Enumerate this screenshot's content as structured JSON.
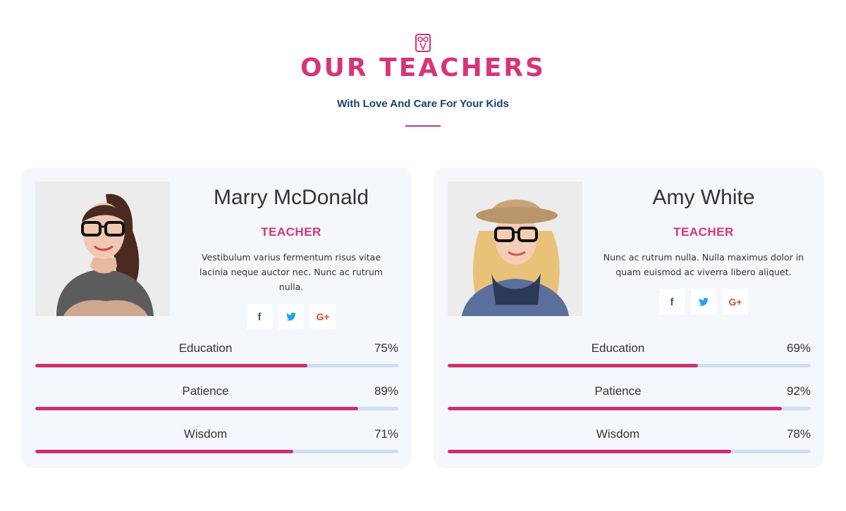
{
  "header": {
    "icon": "owl-icon",
    "title": "OUR TEACHERS",
    "subtitle": "With Love And Care For Your Kids",
    "accent_color": "#d63578",
    "subtitle_color": "#1e3e73"
  },
  "teachers": [
    {
      "name": "Marry McDonald",
      "role": "TEACHER",
      "bio": "Vestibulum varius fermentum risus vitae lacinia neque auctor nec. Nunc ac rutrum nulla.",
      "photo": "teacher-photo",
      "socials": [
        {
          "icon": "facebook-icon",
          "glyph": "f"
        },
        {
          "icon": "twitter-icon",
          "glyph": "🐦"
        },
        {
          "icon": "google-plus-icon",
          "glyph": "G+"
        }
      ],
      "skills": [
        {
          "label": "Education",
          "percent_label": "75%",
          "percent": 75
        },
        {
          "label": "Patience",
          "percent_label": "89%",
          "percent": 89
        },
        {
          "label": "Wisdom",
          "percent_label": "71%",
          "percent": 71
        }
      ]
    },
    {
      "name": "Amy White",
      "role": "TEACHER",
      "bio": "Nunc ac rutrum nulla. Nulla maximus dolor in quam euismod ac viverra libero aliquet.",
      "photo": "teacher-photo",
      "socials": [
        {
          "icon": "facebook-icon",
          "glyph": "f"
        },
        {
          "icon": "twitter-icon",
          "glyph": "🐦"
        },
        {
          "icon": "google-plus-icon",
          "glyph": "G+"
        }
      ],
      "skills": [
        {
          "label": "Education",
          "percent_label": "69%",
          "percent": 69
        },
        {
          "label": "Patience",
          "percent_label": "92%",
          "percent": 92
        },
        {
          "label": "Wisdom",
          "percent_label": "78%",
          "percent": 78
        }
      ]
    }
  ],
  "colors": {
    "bar_fill": "#cc2f73",
    "bar_track": "#cfdcf7",
    "card_bg": "#f4f7fb"
  }
}
